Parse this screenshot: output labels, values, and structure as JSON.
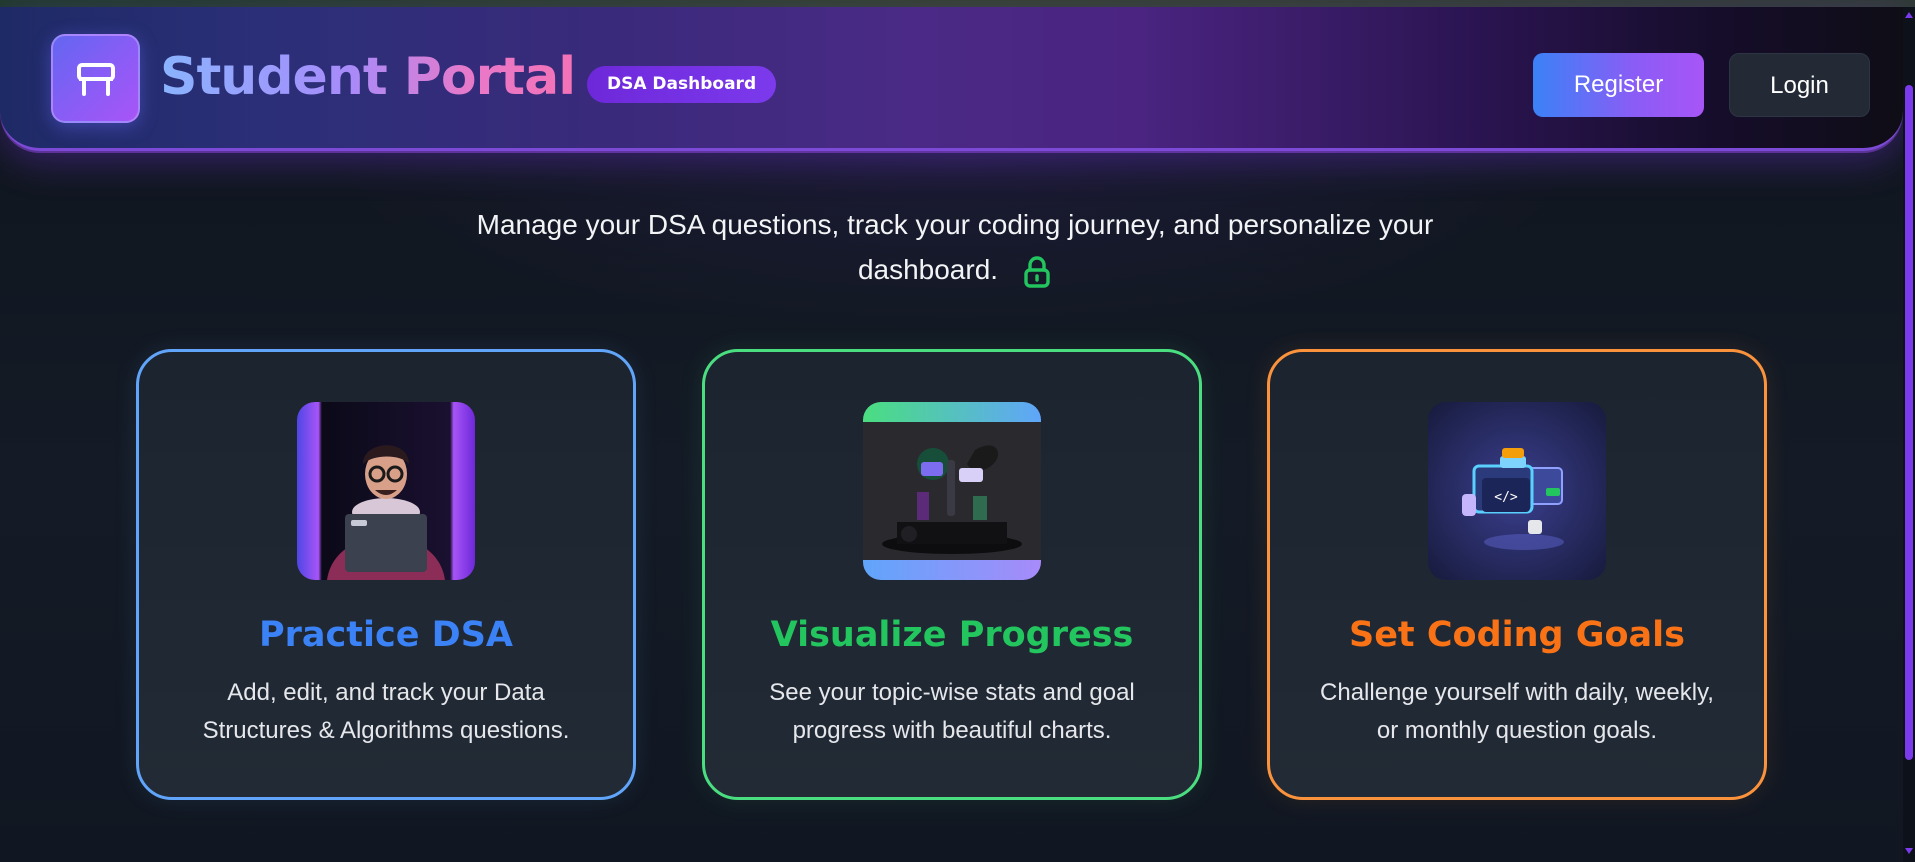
{
  "app": {
    "title": "Student Portal",
    "badge": "DSA Dashboard",
    "logo_icon": "desk-icon"
  },
  "header": {
    "register_label": "Register",
    "login_label": "Login"
  },
  "intro": {
    "text": "Manage your DSA questions, track your coding journey, and personalize your dashboard.",
    "icon": "lock-icon",
    "icon_color": "#22c55e"
  },
  "features": [
    {
      "title": "Practice DSA",
      "description": "Add, edit, and track your Data Structures & Algorithms questions.",
      "accent": "#3b82f6",
      "image": "developer-with-laptop-illustration"
    },
    {
      "title": "Visualize Progress",
      "description": "See your topic-wise stats and goal progress with beautiful charts.",
      "accent": "#22c55e",
      "image": "progress-dashboard-illustration"
    },
    {
      "title": "Set Coding Goals",
      "description": "Challenge yourself with daily, weekly, or monthly question goals.",
      "accent": "#f97316",
      "image": "code-screens-illustration"
    }
  ],
  "colors": {
    "brand_purple": "#7c3aed",
    "background": "#111722"
  }
}
